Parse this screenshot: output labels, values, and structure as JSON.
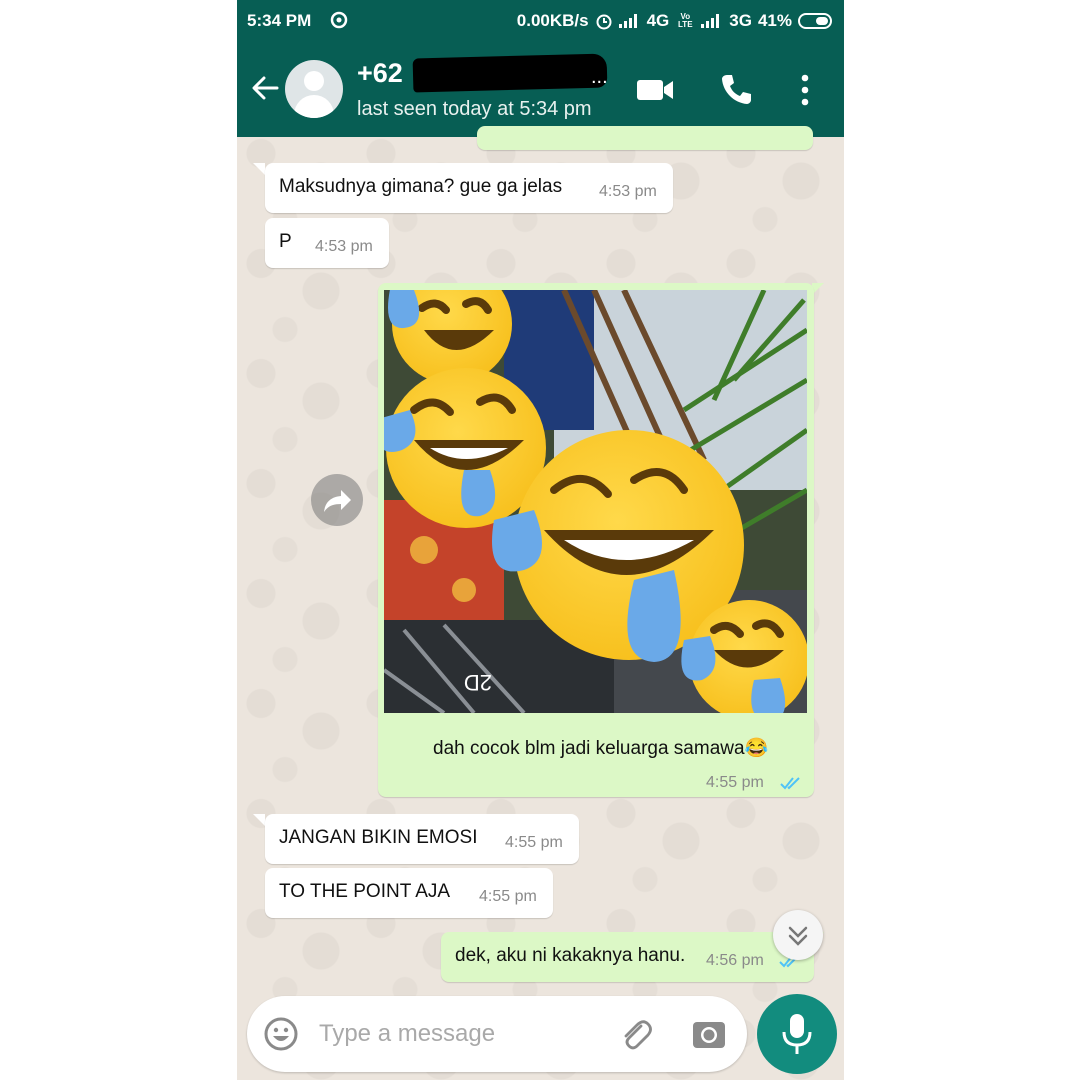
{
  "status_bar": {
    "time": "5:34 PM",
    "network_speed": "0.00KB/s",
    "net1": "4G",
    "volte": "Vo LTE",
    "net2": "3G",
    "battery": "41%"
  },
  "header": {
    "contact_name": "+62",
    "redacted_suffix": "...",
    "last_seen": "last seen today at 5:34 pm",
    "colors": {
      "primary": "#075e54",
      "accent": "#128c7e"
    }
  },
  "messages": [
    {
      "direction": "in",
      "text": "Maksudnya gimana? gue ga jelas",
      "time": "4:53 pm"
    },
    {
      "direction": "in",
      "text": "P",
      "time": "4:53 pm"
    },
    {
      "direction": "out",
      "type": "image",
      "caption": "dah cocok blm jadi keluarga samawa😂",
      "time": "4:55 pm",
      "status": "read"
    },
    {
      "direction": "in",
      "text": "JANGAN BIKIN EMOSI",
      "time": "4:55 pm"
    },
    {
      "direction": "in",
      "text": "TO THE POINT AJA",
      "time": "4:55 pm"
    },
    {
      "direction": "out",
      "text": "dek, aku ni kakaknya hanu.",
      "time": "4:56 pm",
      "status": "read"
    }
  ],
  "photo_overlay_text": "2D",
  "input": {
    "placeholder": "Type a message"
  },
  "icons": [
    "back-arrow-icon",
    "video-call-icon",
    "phone-call-icon",
    "more-options-icon",
    "forward-icon",
    "double-check-icon",
    "emoji-icon",
    "attach-icon",
    "camera-icon",
    "microphone-icon",
    "double-chevron-down-icon"
  ]
}
